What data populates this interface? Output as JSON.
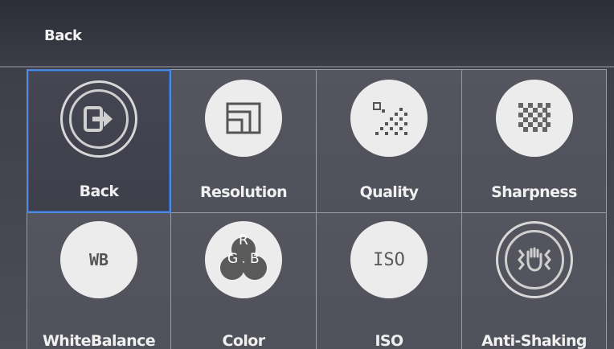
{
  "header": {
    "title": "Back"
  },
  "menu": {
    "items": [
      {
        "label": "Back",
        "icon": "exit-icon"
      },
      {
        "label": "Resolution",
        "icon": "resolution-icon"
      },
      {
        "label": "Quality",
        "icon": "quality-icon"
      },
      {
        "label": "Sharpness",
        "icon": "sharpness-icon"
      },
      {
        "label": "WhiteBalance",
        "icon": "wb-icon",
        "icon_text": "WB"
      },
      {
        "label": "Color",
        "icon": "rgb-icon",
        "icon_letters": [
          "R",
          "G",
          "B"
        ]
      },
      {
        "label": "ISO",
        "icon": "iso-icon",
        "icon_text": "ISO"
      },
      {
        "label": "Anti-Shaking",
        "icon": "anti-shake-icon"
      }
    ],
    "selected_index": 0
  },
  "colors": {
    "selection": "#4d8ae0",
    "grid_line": "#9a9ba3",
    "icon_fill": "#ececec",
    "label": "#f0f0f0"
  }
}
